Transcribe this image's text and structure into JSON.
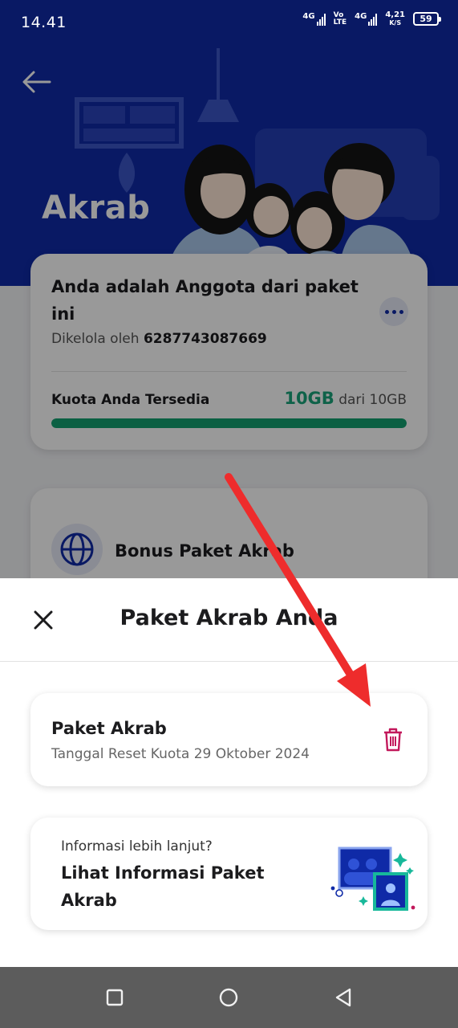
{
  "status_bar": {
    "time": "14.41",
    "net1": "4G",
    "volte_top": "Vo",
    "volte_bottom": "LTE",
    "net2": "4G",
    "speed_value": "4,21",
    "speed_unit": "K/S",
    "battery": "59"
  },
  "header": {
    "back_icon": "arrow-left-icon",
    "title": "Akrab"
  },
  "member_card": {
    "title": "Anda adalah Anggota dari paket ini",
    "managed_prefix": "Dikelola oleh",
    "managed_number": "6287743087669",
    "more_icon": "more-horizontal-icon",
    "quota_label": "Kuota Anda Tersedia",
    "quota_available": "10GB",
    "quota_suffix": "dari 10GB",
    "quota_fraction": 1.0,
    "accent_color": "#13a070"
  },
  "bonus_card": {
    "icon": "globe-icon",
    "label": "Bonus Paket Akrab"
  },
  "sheet": {
    "title": "Paket Akrab Anda",
    "close_icon": "close-icon",
    "package": {
      "name": "Paket Akrab",
      "reset_text": "Tanggal Reset Kuota 29 Oktober 2024",
      "delete_icon": "trash-icon"
    },
    "info": {
      "subtitle": "Informasi lebih lanjut?",
      "link": "Lihat Informasi Paket Akrab"
    }
  },
  "nav_bar": {
    "recent_icon": "square-icon",
    "home_icon": "circle-icon",
    "back_icon": "triangle-back-icon"
  },
  "colors": {
    "brand_blue": "#0f2aa7",
    "trash_red": "#c2185b",
    "annotation_arrow": "#ee2c2c"
  }
}
